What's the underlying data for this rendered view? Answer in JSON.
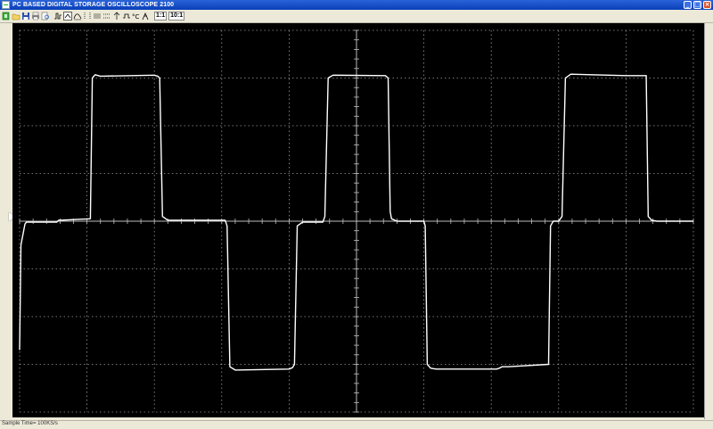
{
  "window": {
    "title": "PC BASED DIGITAL STORAGE OSCILLOSCOPE 2100",
    "buttons": [
      "minimize",
      "maximize",
      "close"
    ]
  },
  "toolbar": {
    "icons": [
      "exit-icon",
      "open-folder-icon",
      "save-icon",
      "print-icon",
      "print-preview-icon",
      "single-shot-icon",
      "trigger-icon",
      "measure-icon",
      "cursor-icon",
      "grid-icon",
      "horizontal-cursor-icon",
      "vertical-cursor-icon",
      "timebase-icon",
      "channel-icon",
      "probe-icon"
    ],
    "probe_1x_label": "1:1",
    "probe_10x_label": "10:1"
  },
  "scope": {
    "background": "#000000",
    "trace_color": "#ffffff",
    "grid_color": "#9a9a9a",
    "divisions_x": 10,
    "divisions_y": 8,
    "trigger_marker": "channel-level-marker",
    "chart_data": {
      "type": "line",
      "title": "",
      "xlabel": "",
      "ylabel": "",
      "xlim": [
        0,
        10
      ],
      "ylim": [
        -4,
        4
      ],
      "grid": true,
      "series": [
        {
          "values_x": [
            0.0,
            0.02,
            0.08,
            0.1,
            0.55,
            0.58,
            0.6,
            1.05,
            1.08,
            1.12,
            1.2,
            2.0,
            2.05,
            2.08,
            2.12,
            2.2,
            3.05,
            3.08,
            3.12,
            3.2,
            4.0,
            4.05,
            4.08,
            4.12,
            4.2,
            4.5,
            4.5,
            4.53,
            4.58,
            4.65,
            5.43,
            5.47,
            5.5,
            5.52,
            5.6,
            6.0,
            6.02,
            6.05,
            6.1,
            6.18,
            7.08,
            7.12,
            7.16,
            7.25,
            7.85,
            7.88,
            7.92,
            8.0,
            8.05,
            8.1,
            8.18,
            9.0,
            9.3,
            9.3,
            9.33,
            9.38,
            9.46,
            10.0
          ],
          "values_y": [
            -2.7,
            -0.5,
            -0.06,
            -0.02,
            -0.02,
            0.02,
            0.02,
            0.05,
            3.0,
            3.07,
            3.04,
            3.06,
            3.04,
            3.0,
            0.1,
            0.02,
            0.02,
            -0.1,
            -3.05,
            -3.12,
            -3.1,
            -3.07,
            -3.0,
            -0.1,
            -0.02,
            -0.02,
            -0.02,
            0.1,
            3.0,
            3.06,
            3.05,
            3.0,
            0.2,
            0.05,
            0.0,
            0.0,
            -0.1,
            -3.0,
            -3.08,
            -3.1,
            -3.1,
            -3.08,
            -3.05,
            -3.05,
            -3.0,
            -0.1,
            0.0,
            0.0,
            0.1,
            3.0,
            3.08,
            3.05,
            3.05,
            3.0,
            0.1,
            0.02,
            0.0,
            0.0
          ]
        }
      ]
    }
  },
  "status": {
    "text": "Sample Time= 100KS/s"
  }
}
